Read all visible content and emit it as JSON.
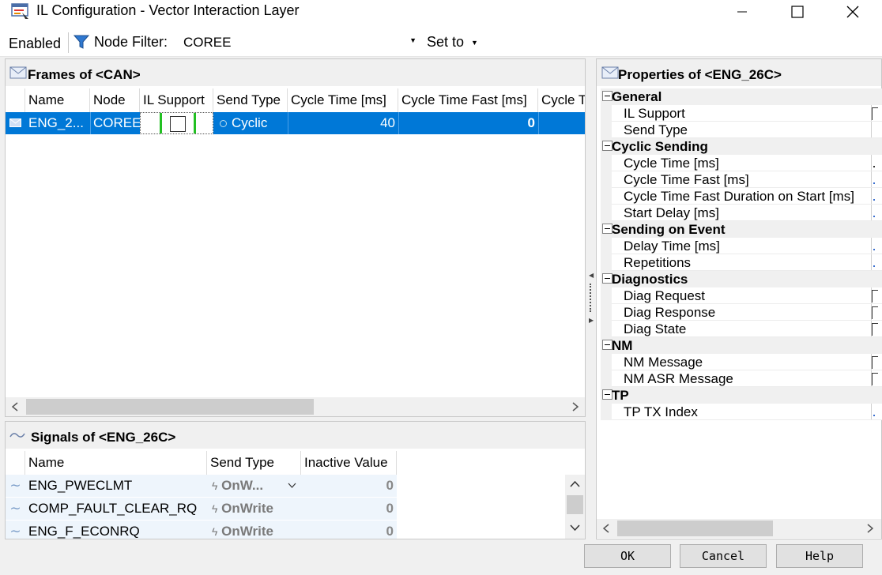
{
  "window": {
    "title": "IL Configuration - Vector Interaction Layer"
  },
  "toolbar": {
    "enabled_label": "Enabled",
    "node_filter_label": "Node Filter:",
    "node_filter_value": "COREE",
    "set_to_label": "Set to"
  },
  "frames": {
    "title": "Frames of <CAN>",
    "columns": [
      "Name",
      "Node",
      "IL Support",
      "Send Type",
      "Cycle Time [ms]",
      "Cycle Time Fast [ms]",
      "Cycle T"
    ],
    "rows": [
      {
        "name": "ENG_2...",
        "node": "COREE",
        "il_support": false,
        "send_type": "Cyclic",
        "cycle_time": "40",
        "cycle_time_fast": "0"
      }
    ]
  },
  "signals": {
    "title": "Signals of <ENG_26C>",
    "columns": [
      "Name",
      "Send Type",
      "Inactive Value"
    ],
    "rows": [
      {
        "name": "ENG_PWECLMT",
        "send_type": "OnW...",
        "inactive_value": "0"
      },
      {
        "name": "COMP_FAULT_CLEAR_RQ",
        "send_type": "OnWrite",
        "inactive_value": "0"
      },
      {
        "name": "ENG_F_ECONRQ",
        "send_type": "OnWrite",
        "inactive_value": "0"
      }
    ]
  },
  "properties": {
    "title": "Properties of <ENG_26C>",
    "categories": [
      {
        "label": "General",
        "items": [
          "IL Support",
          "Send Type"
        ]
      },
      {
        "label": "Cyclic Sending",
        "items": [
          "Cycle Time [ms]",
          "Cycle Time Fast [ms]",
          "Cycle Time Fast Duration on Start [ms]",
          "Start Delay [ms]"
        ]
      },
      {
        "label": "Sending on Event",
        "items": [
          "Delay Time [ms]",
          "Repetitions"
        ]
      },
      {
        "label": "Diagnostics",
        "items": [
          "Diag Request",
          "Diag Response",
          "Diag State"
        ]
      },
      {
        "label": "NM",
        "items": [
          "NM Message",
          "NM ASR Message"
        ]
      },
      {
        "label": "TP",
        "items": [
          "TP TX Index"
        ]
      }
    ]
  },
  "buttons": {
    "ok": "OK",
    "cancel": "Cancel",
    "help": "Help"
  },
  "colors": {
    "selection": "#0078d7",
    "highlight_box": "#22c022",
    "signal_row_bg": "#eef5fc"
  }
}
